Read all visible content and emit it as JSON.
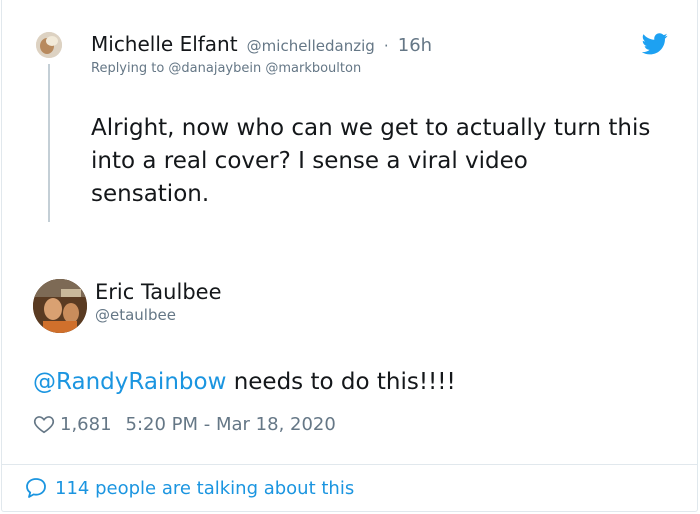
{
  "reply": {
    "name": "Michelle Elfant",
    "handle": "@michelledanzig",
    "separator": "·",
    "time": "16h",
    "replying_to": "Replying to @danajaybein @markboulton",
    "text": "Alright, now who can we get to actually turn this into a real cover? I sense a viral video sensation."
  },
  "tweet": {
    "name": "Eric Taulbee",
    "handle": "@etaulbee",
    "mention": "@RandyRainbow",
    "text_rest": " needs to do this!!!!",
    "likes": "1,681",
    "timestamp": "5:20 PM - Mar 18, 2020"
  },
  "footer": {
    "talking": "114 people are talking about this"
  },
  "colors": {
    "twitter_blue": "#1da1f2",
    "link_blue": "#1b95e0",
    "muted": "#657786"
  },
  "icons": [
    "twitter-bird-icon",
    "heart-icon",
    "speech-bubble-icon"
  ]
}
